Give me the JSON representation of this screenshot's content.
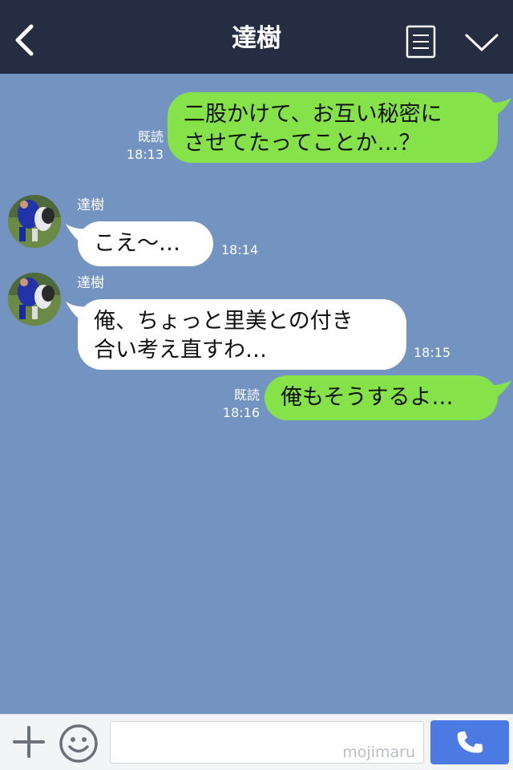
{
  "header": {
    "title": "達樹",
    "back_icon": "chevron-left-icon",
    "notes_icon": "notes-icon",
    "menu_icon": "chevron-down-icon"
  },
  "messages": [
    {
      "side": "me",
      "lines": [
        "二股かけて、お互い秘密に",
        "させてたってことか…？"
      ],
      "read": "既読",
      "time": "18:13"
    },
    {
      "side": "them",
      "sender": "達樹",
      "lines": [
        "こえ〜…"
      ],
      "time": "18:14"
    },
    {
      "side": "them",
      "sender": "達樹",
      "lines": [
        "俺、ちょっと里美との付き",
        "合い考え直すわ…"
      ],
      "time": "18:15"
    },
    {
      "side": "me",
      "lines": [
        "俺もそうするよ…"
      ],
      "read": "既読",
      "time": "18:16"
    }
  ],
  "input": {
    "watermark": "mojimaru",
    "placeholder": ""
  },
  "colors": {
    "header_bg": "#242d42",
    "chat_bg": "#7393c0",
    "my_bubble": "#85e249",
    "their_bubble": "#ffffff",
    "call_button": "#4a7ae2"
  }
}
